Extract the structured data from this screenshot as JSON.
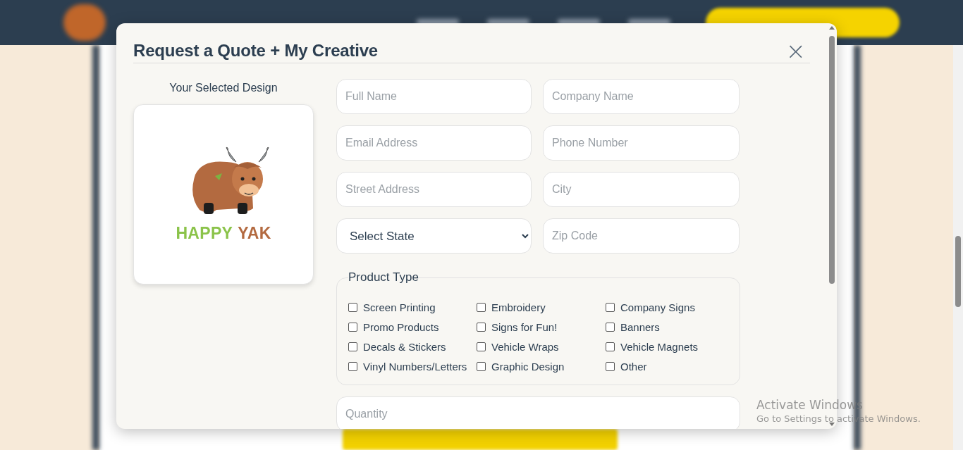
{
  "modal": {
    "title": "Request a Quote + My Creative",
    "close_label": "×",
    "design": {
      "label": "Your Selected Design",
      "logo_words": [
        "HAPPY",
        "YAK"
      ]
    },
    "fields": [
      {
        "kind": "input",
        "placeholder": "Full Name"
      },
      {
        "kind": "input",
        "placeholder": "Company Name"
      },
      {
        "kind": "input",
        "placeholder": "Email Address"
      },
      {
        "kind": "input",
        "placeholder": "Phone Number"
      },
      {
        "kind": "input",
        "placeholder": "Street Address"
      },
      {
        "kind": "input",
        "placeholder": "City"
      },
      {
        "kind": "select",
        "value": "Select State"
      },
      {
        "kind": "input",
        "placeholder": "Zip Code"
      }
    ],
    "product_type": {
      "legend": "Product Type",
      "options": [
        {
          "label": "Screen Printing",
          "checked": false
        },
        {
          "label": "Embroidery",
          "checked": false
        },
        {
          "label": "Company Signs",
          "checked": false
        },
        {
          "label": "Promo Products",
          "checked": false
        },
        {
          "label": "Signs for Fun!",
          "checked": false
        },
        {
          "label": "Banners",
          "checked": false
        },
        {
          "label": "Decals & Stickers",
          "checked": false
        },
        {
          "label": "Vehicle Wraps",
          "checked": false
        },
        {
          "label": "Vehicle Magnets",
          "checked": false
        },
        {
          "label": "Vinyl Numbers/Letters",
          "checked": false
        },
        {
          "label": "Graphic Design",
          "checked": false
        },
        {
          "label": "Other",
          "checked": false
        }
      ]
    },
    "quantity": {
      "placeholder": "Quantity"
    }
  },
  "watermark": {
    "title": "Activate Windows",
    "text": "Go to Settings to activate Windows."
  }
}
